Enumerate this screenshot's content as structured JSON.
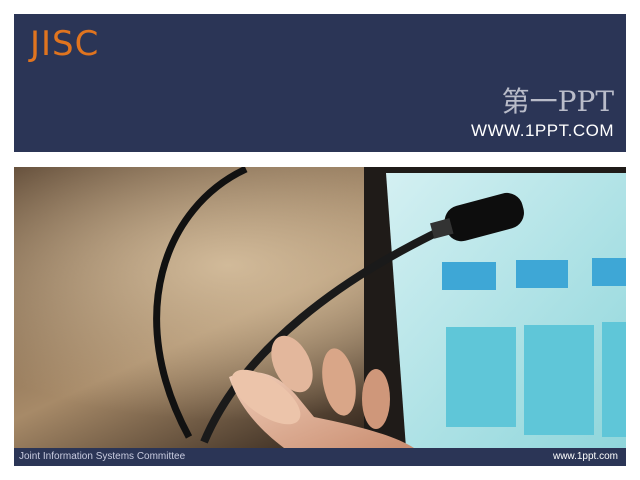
{
  "header": {
    "logo_text": "JISC",
    "title": "第一PPT",
    "url": "WWW.1PPT.COM"
  },
  "photo": {
    "subject": "conference-microphone-and-hand-photo"
  },
  "footer": {
    "left_text": "Joint Information Systems Committee",
    "right_text": "www.1ppt.com"
  },
  "colors": {
    "header_bg": "#2b3556",
    "logo": "#e0741f",
    "title": "#b9bcc9"
  }
}
